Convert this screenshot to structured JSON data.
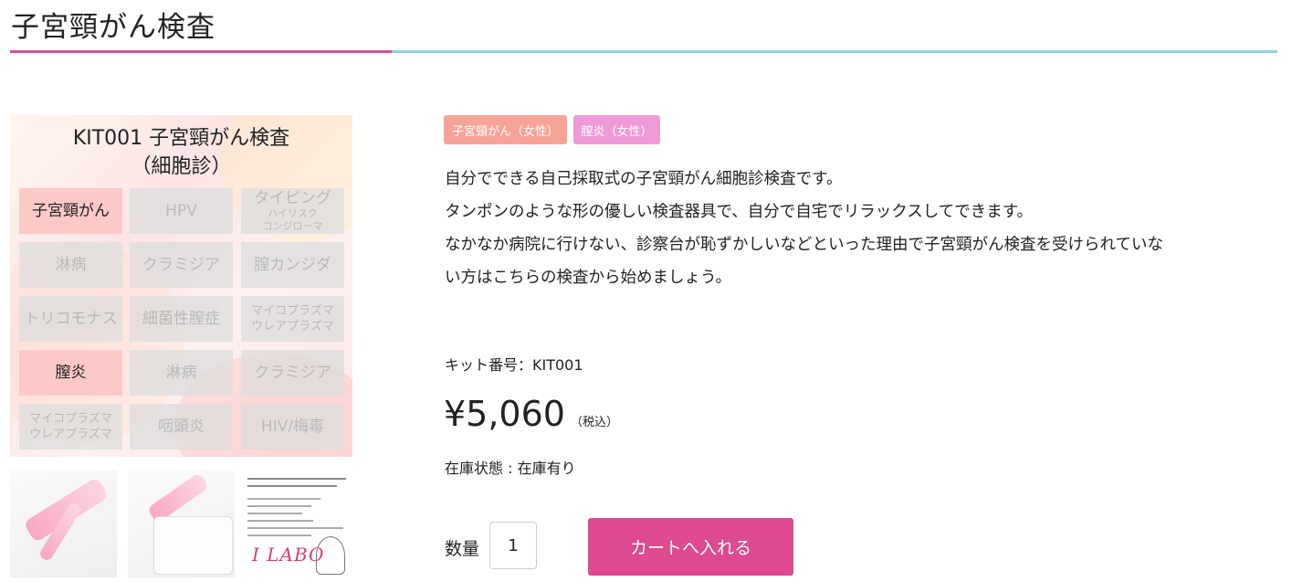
{
  "page": {
    "title": "子宮頸がん検査",
    "accent_color": "#d6508f",
    "secondary_color": "#8fd3df"
  },
  "product_image": {
    "title_line1": "KIT001 子宮頸がん検査",
    "title_line2": "（細胞診）",
    "cells": [
      {
        "label": "子宮頸がん",
        "active": true
      },
      {
        "label": "HPV",
        "active": false
      },
      {
        "label": "タイピング",
        "sub": "ハイリスク\nコンジローマ",
        "active": false
      },
      {
        "label": "淋病",
        "active": false
      },
      {
        "label": "クラミジア",
        "active": false
      },
      {
        "label": "膣カンジダ",
        "active": false
      },
      {
        "label": "トリコモナス",
        "active": false
      },
      {
        "label": "細菌性膣症",
        "active": false
      },
      {
        "label": "マイコプラズマ\nウレアプラズマ",
        "active": false
      },
      {
        "label": "膣炎",
        "active": true
      },
      {
        "label": "淋病",
        "active": false
      },
      {
        "label": "クラミジア",
        "active": false
      },
      {
        "label": "マイコプラズマ\nウレアプラズマ",
        "active": false
      },
      {
        "label": "咽頭炎",
        "active": false
      },
      {
        "label": "HIV/梅毒",
        "active": false
      }
    ]
  },
  "thumbnails": {
    "thumb3_logo": "I LABO"
  },
  "tags": [
    {
      "label": "子宮頸がん（女性）",
      "color": "#f7a498"
    },
    {
      "label": "膣炎（女性）",
      "color": "#ef9ad6"
    }
  ],
  "description": [
    "自分でできる自己採取式の子宮頸がん細胞診検査です。",
    "タンポンのような形の優しい検査器具で、自分で自宅でリラックスしてできます。",
    "なかなか病院に行けない、診察台が恥ずかしいなどといった理由で子宮頸がん検査を受けられていな",
    "い方はこちらの検査から始めましょう。"
  ],
  "kit_number": "キット番号：KIT001",
  "price": {
    "amount": "¥5,060",
    "tax_note": "（税込）"
  },
  "stock": "在庫状態 : 在庫有り",
  "quantity": {
    "label": "数量",
    "value": "1"
  },
  "cart_button": {
    "label": "カートへ入れる",
    "color": "#dd4a8f"
  }
}
